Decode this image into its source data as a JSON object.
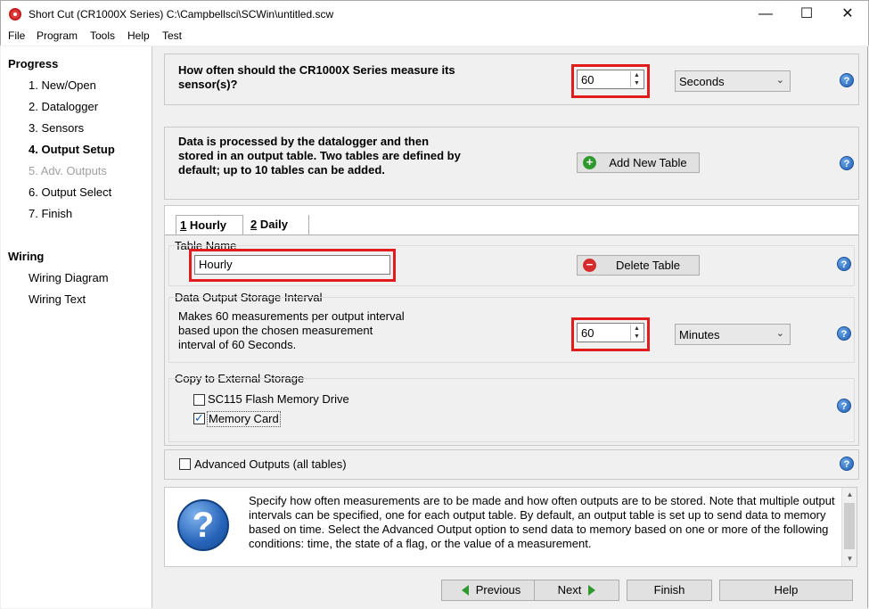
{
  "window": {
    "title": "Short Cut (CR1000X Series) C:\\Campbellsci\\SCWin\\untitled.scw",
    "minimize": "—",
    "maximize": "☐",
    "close": "✕"
  },
  "menu": {
    "file": "File",
    "program": "Program",
    "tools": "Tools",
    "help": "Help",
    "test": "Test"
  },
  "sidebar": {
    "progress_heading": "Progress",
    "progress_items": [
      {
        "label": "1. New/Open",
        "state": "normal"
      },
      {
        "label": "2. Datalogger",
        "state": "normal"
      },
      {
        "label": "3. Sensors",
        "state": "normal"
      },
      {
        "label": "4. Output Setup",
        "state": "active"
      },
      {
        "label": "5. Adv. Outputs",
        "state": "disabled"
      },
      {
        "label": "6. Output Select",
        "state": "normal"
      },
      {
        "label": "7. Finish",
        "state": "normal"
      }
    ],
    "wiring_heading": "Wiring",
    "wiring_items": [
      {
        "label": "Wiring Diagram"
      },
      {
        "label": "Wiring Text"
      }
    ]
  },
  "measure": {
    "question": "How often should the CR1000X Series measure its sensor(s)?",
    "interval_value": "60",
    "unit": "Seconds"
  },
  "tables_info": {
    "text": "Data is processed by the datalogger and then stored in an output table. Two tables are defined by default; up to 10 tables can be added.",
    "add_button": "Add New Table"
  },
  "tabs": [
    {
      "number": "1",
      "name": "Hourly",
      "selected": true
    },
    {
      "number": "2",
      "name": "Daily",
      "selected": false
    }
  ],
  "table_name": {
    "label": "Table Name",
    "value": "Hourly",
    "delete_button": "Delete Table"
  },
  "output_interval": {
    "label": "Data Output Storage Interval",
    "description": "Makes 60 measurements per output interval based upon the chosen measurement interval of 60 Seconds.",
    "value": "60",
    "unit": "Minutes"
  },
  "external_storage": {
    "label": "Copy to External Storage",
    "options": [
      {
        "label": "SC115 Flash Memory Drive",
        "checked": false
      },
      {
        "label": "Memory Card",
        "checked": true
      }
    ]
  },
  "advanced_outputs": {
    "label": "Advanced Outputs (all tables)",
    "checked": false
  },
  "help_text": "Specify how often measurements are to be made and how often outputs are to be stored. Note that multiple output intervals can be specified, one for each output table. By default, an output table is set up to send data to memory based on time. Select the Advanced Output option to send data to memory based on one or more of the following conditions: time, the state of a flag, or the value of a measurement.",
  "nav": {
    "previous": "Previous",
    "next": "Next",
    "finish": "Finish",
    "help": "Help"
  },
  "colors": {
    "highlight_red": "#e21c1c",
    "help_icon_blue": "#1f5fb6",
    "nav_arrow_green": "#2e9a2e"
  }
}
